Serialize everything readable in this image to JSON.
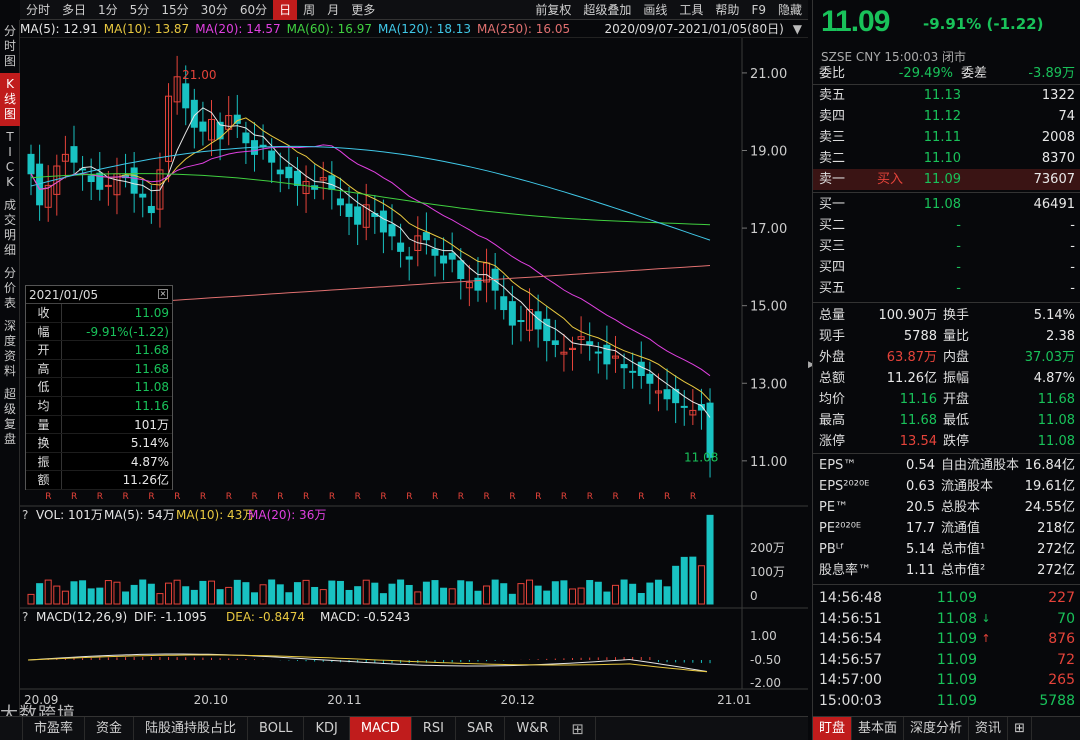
{
  "toolbar": {
    "tabs": [
      "分时",
      "多日",
      "1分",
      "5分",
      "15分",
      "30分",
      "60分",
      "日",
      "周",
      "月",
      "更多"
    ],
    "active": "日",
    "right": [
      "前复权",
      "超级叠加",
      "画线",
      "工具",
      "帮助",
      "F9",
      "隐藏"
    ]
  },
  "left_tabs": [
    "分\n时\n图",
    "K\n线\n图",
    "T\nI\nC\nK",
    "成\n交\n明\n细",
    "分\n价\n表",
    "深\n度\n资\n料",
    "超\n级\n复\n盘"
  ],
  "ma_line": [
    {
      "label": "MA(5): 12.91",
      "color": "#e6e6e6"
    },
    {
      "label": "MA(10): 13.87",
      "color": "#e8c840"
    },
    {
      "label": "MA(20): 14.57",
      "color": "#e040e0"
    },
    {
      "label": "MA(60): 16.97",
      "color": "#40d040"
    },
    {
      "label": "MA(120): 18.13",
      "color": "#40c8e8"
    },
    {
      "label": "MA(250): 16.05",
      "color": "#e07070"
    }
  ],
  "date_range": "2020/09/07-2021/01/05(80日)",
  "price_axis": [
    "21.00",
    "19.00",
    "17.00",
    "15.00",
    "13.00",
    "11.00"
  ],
  "max_label": "21.00",
  "min_label": "11.08",
  "x_axis": [
    "20.09",
    "20.10",
    "20.11",
    "20.12",
    "21.01"
  ],
  "vol_line": [
    {
      "label": "VOL: 101万",
      "color": "#e6e6e6"
    },
    {
      "label": "MA(5): 54万",
      "color": "#e6e6e6"
    },
    {
      "label": "MA(10): 43万",
      "color": "#e8c840"
    },
    {
      "label": "MA(20): 36万",
      "color": "#e040e0"
    }
  ],
  "vol_axis": [
    "200万",
    "100万",
    "0"
  ],
  "macd_line": [
    {
      "label": "MACD(12,26,9)",
      "color": "#e6e6e6"
    },
    {
      "label": "DIF: -1.1095",
      "color": "#e6e6e6"
    },
    {
      "label": "DEA: -0.8474",
      "color": "#e8c840"
    },
    {
      "label": "MACD: -0.5243",
      "color": "#e6e6e6"
    }
  ],
  "macd_axis": [
    "1.00",
    "-0.50",
    "-2.00"
  ],
  "info_box": {
    "date": "2021/01/05",
    "rows": [
      {
        "k": "收",
        "v": "11.09",
        "c": "g"
      },
      {
        "k": "幅",
        "v": "-9.91%(-1.22)",
        "c": "g"
      },
      {
        "k": "开",
        "v": "11.68",
        "c": "g"
      },
      {
        "k": "高",
        "v": "11.68",
        "c": "g"
      },
      {
        "k": "低",
        "v": "11.08",
        "c": "g"
      },
      {
        "k": "均",
        "v": "11.16",
        "c": "g"
      },
      {
        "k": "量",
        "v": "101万",
        "c": "w"
      },
      {
        "k": "换",
        "v": "5.14%",
        "c": "w"
      },
      {
        "k": "振",
        "v": "4.87%",
        "c": "w"
      },
      {
        "k": "额",
        "v": "11.26亿",
        "c": "w"
      }
    ]
  },
  "bottom_tabs": [
    "市盈率",
    "资金",
    "陆股通持股占比",
    "BOLL",
    "KDJ",
    "MACD",
    "RSI",
    "SAR",
    "W&R"
  ],
  "bottom_active": "MACD",
  "watermark": "大数跨境",
  "quote": {
    "price": "11.09",
    "change": "-9.91% (-1.22)",
    "exchange": "SZSE  CNY  15:00:03  闭市",
    "webi_label": "委比",
    "webi": "-29.49%",
    "weicha_label": "委差",
    "weicha": "-3.89万",
    "asks": [
      {
        "k": "卖五",
        "p": "11.13",
        "v": "1322",
        "tag": ""
      },
      {
        "k": "卖四",
        "p": "11.12",
        "v": "74",
        "tag": ""
      },
      {
        "k": "卖三",
        "p": "11.11",
        "v": "2008",
        "tag": ""
      },
      {
        "k": "卖二",
        "p": "11.10",
        "v": "8370",
        "tag": ""
      },
      {
        "k": "卖一",
        "p": "11.09",
        "v": "73607",
        "tag": "买入"
      }
    ],
    "bids": [
      {
        "k": "买一",
        "p": "11.08",
        "v": "46491"
      },
      {
        "k": "买二",
        "p": "-",
        "v": "-"
      },
      {
        "k": "买三",
        "p": "-",
        "v": "-"
      },
      {
        "k": "买四",
        "p": "-",
        "v": "-"
      },
      {
        "k": "买五",
        "p": "-",
        "v": "-"
      }
    ],
    "stats": [
      {
        "k1": "总量",
        "v1": "100.90万",
        "c1": "w",
        "k2": "换手",
        "v2": "5.14%",
        "c2": "w"
      },
      {
        "k1": "现手",
        "v1": "5788",
        "c1": "w",
        "k2": "量比",
        "v2": "2.38",
        "c2": "w"
      },
      {
        "k1": "外盘",
        "v1": "63.87万",
        "c1": "r",
        "k2": "内盘",
        "v2": "37.03万",
        "c2": "g"
      },
      {
        "k1": "总额",
        "v1": "11.26亿",
        "c1": "w",
        "k2": "振幅",
        "v2": "4.87%",
        "c2": "w"
      },
      {
        "k1": "均价",
        "v1": "11.16",
        "c1": "g",
        "k2": "开盘",
        "v2": "11.68",
        "c2": "g"
      },
      {
        "k1": "最高",
        "v1": "11.68",
        "c1": "g",
        "k2": "最低",
        "v2": "11.08",
        "c2": "g"
      },
      {
        "k1": "涨停",
        "v1": "13.54",
        "c1": "r",
        "k2": "跌停",
        "v2": "11.08",
        "c2": "g"
      }
    ],
    "fundamentals": [
      {
        "k1": "EPS™",
        "v1": "0.54",
        "k2": "自由流通股本",
        "v2": "16.84亿"
      },
      {
        "k1": "EPS²⁰²⁰ᴱ",
        "v1": "0.63",
        "k2": "流通股本",
        "v2": "19.61亿"
      },
      {
        "k1": "PE™",
        "v1": "20.5",
        "k2": "总股本",
        "v2": "24.55亿"
      },
      {
        "k1": "PE²⁰²⁰ᴱ",
        "v1": "17.7",
        "k2": "流通值",
        "v2": "218亿"
      },
      {
        "k1": "PBᴸᶠ",
        "v1": "5.14",
        "k2": "总市值¹",
        "v2": "272亿"
      },
      {
        "k1": "股息率™",
        "v1": "1.11",
        "k2": "总市值²",
        "v2": "272亿"
      }
    ],
    "ticks": [
      {
        "t": "14:56:48",
        "p": "11.09",
        "ar": "",
        "q": "227",
        "qc": "r"
      },
      {
        "t": "14:56:51",
        "p": "11.08",
        "ar": "↓",
        "arc": "g",
        "q": "70",
        "qc": "g"
      },
      {
        "t": "14:56:54",
        "p": "11.09",
        "ar": "↑",
        "arc": "r",
        "q": "876",
        "qc": "r"
      },
      {
        "t": "14:56:57",
        "p": "11.09",
        "ar": "",
        "q": "72",
        "qc": "r"
      },
      {
        "t": "14:57:00",
        "p": "11.09",
        "ar": "",
        "q": "265",
        "qc": "r"
      },
      {
        "t": "15:00:03",
        "p": "11.09",
        "ar": "",
        "q": "5788",
        "qc": "g"
      }
    ],
    "tabs": [
      "盯盘",
      "基本面",
      "深度分析",
      "资讯"
    ],
    "tab_active": "盯盘"
  },
  "colors": {
    "up": "#e5433a",
    "down": "#19c2c2",
    "green": "#19c25a",
    "active": "#c01c1c"
  }
}
